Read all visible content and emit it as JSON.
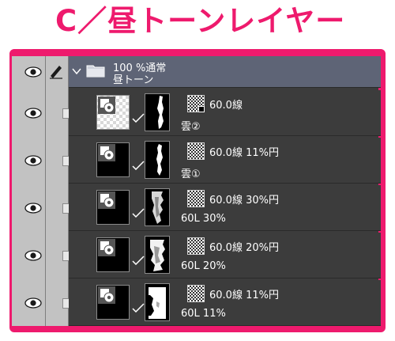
{
  "banner": {
    "title": "C／昼トーンレイヤー"
  },
  "colors": {
    "accent": "#ee1a6d",
    "panel": "#3c3c3c",
    "folder_row": "#5e6476",
    "column": "#c2c2c2"
  },
  "panel": {
    "folder": {
      "icon": "folder-icon",
      "opacity_blend": "100 %通常",
      "name": "昼トーン"
    },
    "layers": [
      {
        "tone": "60.0線",
        "name": "雲②"
      },
      {
        "tone": "60.0線 11%円",
        "name": "雲①"
      },
      {
        "tone": "60.0線 30%円",
        "name": "60L 30%"
      },
      {
        "tone": "60.0線 20%円",
        "name": "60L 20%"
      },
      {
        "tone": "60.0線 11%円",
        "name": "60L 11%"
      }
    ]
  }
}
